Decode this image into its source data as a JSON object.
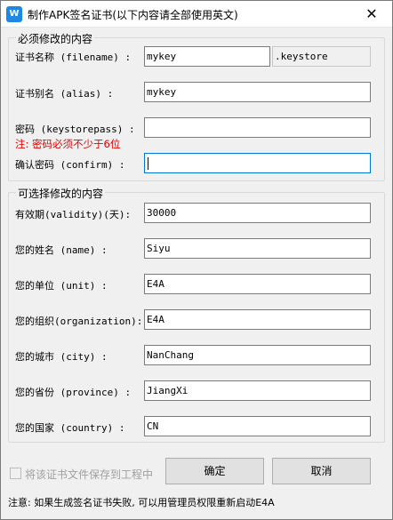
{
  "window": {
    "title": "制作APK签名证书(以下内容请全部使用英文)",
    "app_icon": "W",
    "close_symbol": "✕"
  },
  "required_group": {
    "legend": "必须修改的内容",
    "filename_label": "证书名称 (filename) :",
    "filename_value": "mykey",
    "filename_ext": ".keystore",
    "alias_label": "证书别名 (alias) :",
    "alias_value": "mykey",
    "password_label": "密码 (keystorepass) :",
    "password_value": "",
    "password_note": "注: 密码必须不少于6位",
    "confirm_label": "确认密码 (confirm) :",
    "confirm_value": ""
  },
  "optional_group": {
    "legend": "可选择修改的内容",
    "fields": [
      {
        "label": "有效期(validity)(天):",
        "value": "30000"
      },
      {
        "label": "您的姓名 (name) :",
        "value": "Siyu"
      },
      {
        "label": "您的单位 (unit) :",
        "value": "E4A"
      },
      {
        "label": "您的组织(organization):",
        "value": "E4A"
      },
      {
        "label": "您的城市 (city) :",
        "value": "NanChang"
      },
      {
        "label": "您的省份 (province) :",
        "value": "JiangXi"
      },
      {
        "label": "您的国家 (country) :",
        "value": "CN"
      }
    ]
  },
  "save_to_project_label": "将该证书文件保存到工程中",
  "save_to_project_checked": false,
  "buttons": {
    "ok": "确定",
    "cancel": "取消"
  },
  "footer_note": "注意: 如果生成签名证书失败, 可以用管理员权限重新启动E4A"
}
